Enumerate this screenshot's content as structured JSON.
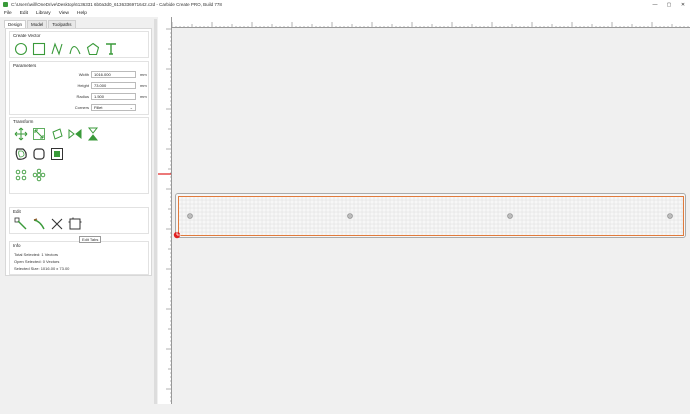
{
  "window": {
    "title": "C:\\Users\\will\\OneDrive\\Desktop\\6136331 6b0a3d0_6136336971642.c2d - Carbide Create PRO, Build 778",
    "controls": [
      "—",
      "▢",
      "✕"
    ]
  },
  "menu": [
    "File",
    "Edit",
    "Library",
    "View",
    "Help"
  ],
  "tabs": [
    "Design",
    "Model",
    "Toolpaths"
  ],
  "create_vector": {
    "title": "Create Vector"
  },
  "parameters": {
    "title": "Parameters",
    "rows": [
      {
        "label": "Width",
        "value": "1016.000",
        "unit": "mm"
      },
      {
        "label": "Height",
        "value": "73.000",
        "unit": "mm"
      },
      {
        "label": "Radius",
        "value": "1.500",
        "unit": "mm"
      },
      {
        "label": "Corners",
        "value": "Fillet",
        "unit": ""
      }
    ]
  },
  "transform": {
    "title": "Transform"
  },
  "edit": {
    "title": "Edit",
    "tooltip": "Edit Tabs"
  },
  "info": {
    "title": "Info",
    "rows": [
      {
        "label": "Total Selected:",
        "value": "1 Vectors"
      },
      {
        "label": "Open Selected:",
        "value": "0 Vectors"
      },
      {
        "label": "Selected Size:",
        "value": "1016.00 x 73.00"
      }
    ]
  },
  "colors": {
    "icon": "#3a9a3a",
    "selection": "#e07a3c",
    "origin": "#e02020"
  }
}
